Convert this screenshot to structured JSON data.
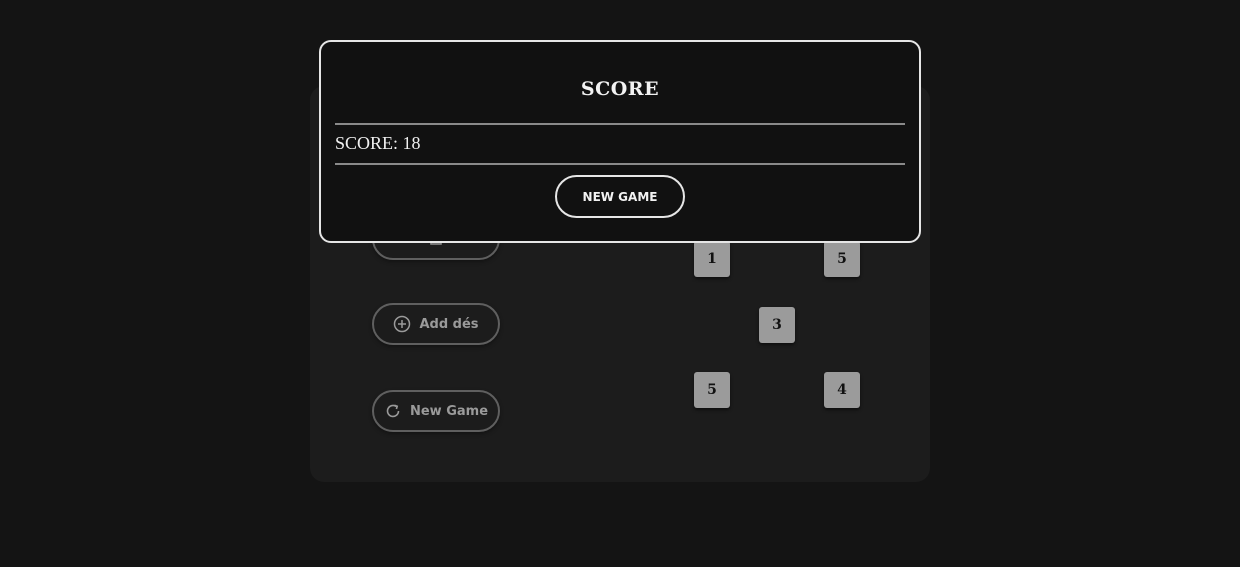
{
  "game": {
    "add_dice_label": "Add dés",
    "new_game_label": "New Game",
    "dice": [
      "1",
      "5",
      "3",
      "5",
      "4"
    ]
  },
  "modal": {
    "title": "SCORE",
    "score_text": "SCORE: 18",
    "button_label": "NEW GAME"
  },
  "icons": {
    "partial_top_button": "square-icon",
    "add": "plus-circle-icon",
    "new_game": "refresh-icon"
  },
  "colors": {
    "background": "#141414",
    "panel": "#1c1c1c",
    "modal_border": "#e6e6e6",
    "die_face": "#9b9b9b"
  }
}
